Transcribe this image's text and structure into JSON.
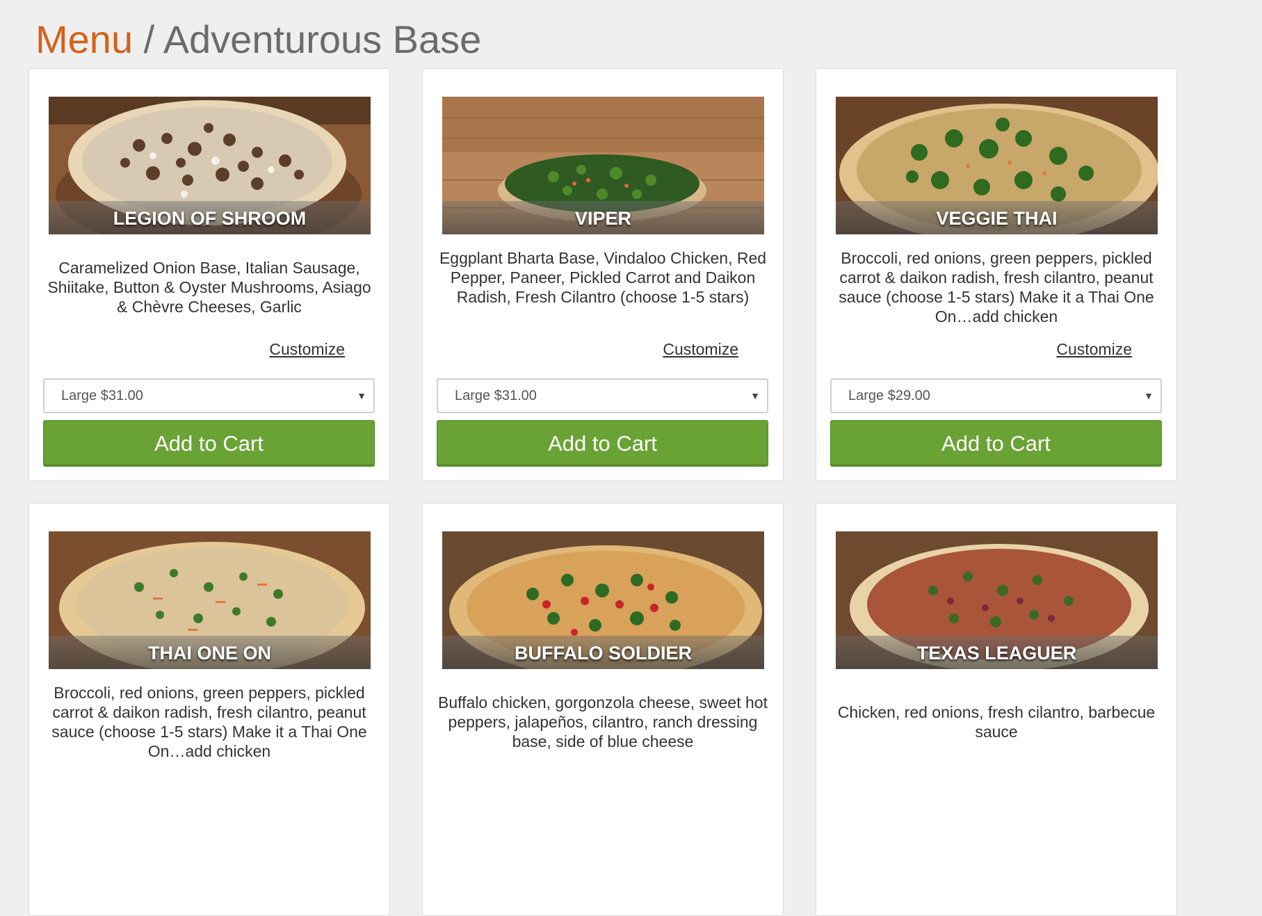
{
  "breadcrumb": {
    "link": "Menu",
    "separator": " / ",
    "current": "Adventurous Base"
  },
  "colors": {
    "accent": "#d4621b",
    "button_green": "#6aa335",
    "page_bg": "#efefef"
  },
  "items": [
    {
      "name": "LEGION OF SHROOM",
      "description": "Caramelized Onion Base, Italian Sausage, Shiitake, Button & Oyster Mushrooms, Asiago & Chèvre Cheeses, Garlic",
      "customize": "Customize",
      "size": "Large $31.00",
      "add": "Add to Cart",
      "image_icon": "pizza-mushroom-photo"
    },
    {
      "name": "VIPER",
      "description": "Eggplant Bharta Base, Vindaloo Chicken, Red Pepper, Paneer, Pickled Carrot and Daikon Radish, Fresh Cilantro (choose 1-5 stars)",
      "customize": "Customize",
      "size": "Large $31.00",
      "add": "Add to Cart",
      "image_icon": "pizza-greens-photo"
    },
    {
      "name": "VEGGIE THAI",
      "description": "Broccoli, red onions, green peppers, pickled carrot & daikon radish, fresh cilantro, peanut sauce (choose 1-5 stars) Make it a Thai One On…add chicken",
      "customize": "Customize",
      "size": "Large $29.00",
      "add": "Add to Cart",
      "image_icon": "pizza-broccoli-photo"
    },
    {
      "name": "THAI ONE ON",
      "description": "Broccoli, red onions, green peppers, pickled carrot & daikon radish, fresh cilantro, peanut sauce (choose 1-5 stars) Make it a Thai One On…add chicken",
      "image_icon": "pizza-cilantro-photo"
    },
    {
      "name": "BUFFALO SOLDIER",
      "description": "Buffalo chicken, gorgonzola cheese, sweet hot peppers, jalapeños, cilantro, ranch dressing base, side of blue cheese",
      "image_icon": "pizza-peppers-photo"
    },
    {
      "name": "TEXAS LEAGUER",
      "description": "Chicken, red onions, fresh cilantro, barbecue sauce",
      "image_icon": "pizza-bbq-photo"
    }
  ]
}
